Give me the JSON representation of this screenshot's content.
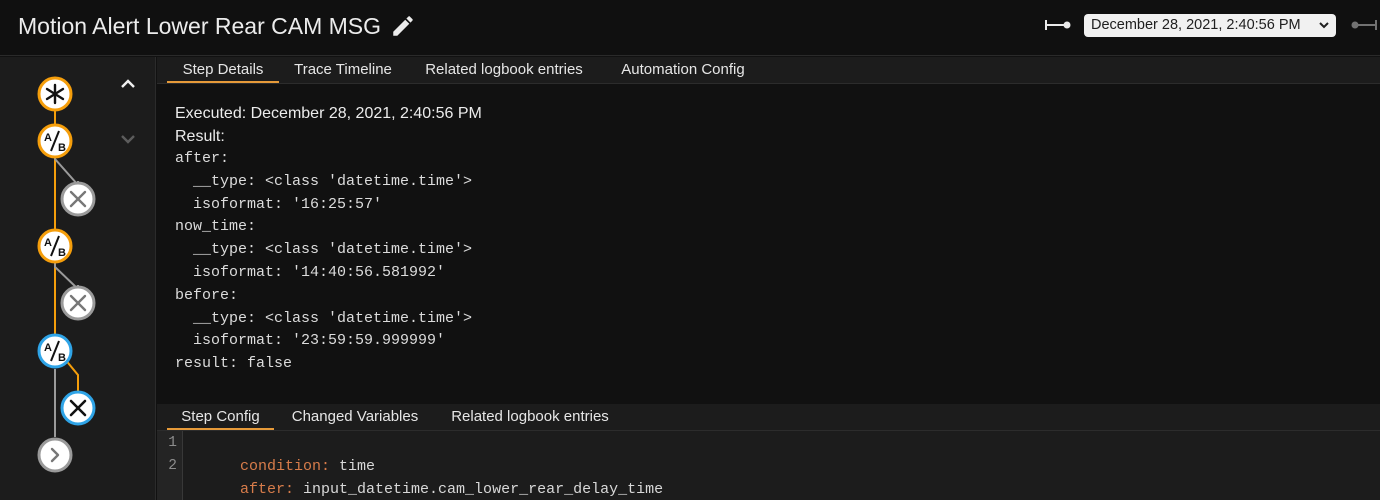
{
  "header": {
    "title": "Motion Alert Lower Rear CAM MSG",
    "trace_selected": "December 28, 2021, 2:40:56 PM"
  },
  "tabs_top": [
    "Step Details",
    "Trace Timeline",
    "Related logbook entries",
    "Automation Config"
  ],
  "details": {
    "executed": "Executed: December 28, 2021, 2:40:56 PM",
    "result_label": "Result:",
    "yaml_lines": [
      "after:",
      "  __type: <class 'datetime.time'>",
      "  isoformat: '16:25:57'",
      "now_time:",
      "  __type: <class 'datetime.time'>",
      "  isoformat: '14:40:56.581992'",
      "before:",
      "  __type: <class 'datetime.time'>",
      "  isoformat: '23:59:59.999999'",
      "result: false"
    ]
  },
  "tabs_bottom": [
    "Step Config",
    "Changed Variables",
    "Related logbook entries"
  ],
  "config": {
    "lines": [
      {
        "num": "1",
        "key": "condition:",
        "value": " time"
      },
      {
        "num": "2",
        "key": "after:",
        "value": " input_datetime.cam_lower_rear_delay_time"
      }
    ]
  },
  "graph": {
    "nodes": [
      {
        "name": "trigger-node",
        "icon": "asterisk-icon",
        "state": "traced"
      },
      {
        "name": "condition-node-1",
        "icon": "a-b-icon",
        "state": "traced"
      },
      {
        "name": "stop-node-1",
        "icon": "close-icon",
        "state": "untraced"
      },
      {
        "name": "condition-node-2",
        "icon": "a-b-icon",
        "state": "traced"
      },
      {
        "name": "stop-node-2",
        "icon": "close-icon",
        "state": "untraced"
      },
      {
        "name": "condition-node-3",
        "icon": "a-b-icon",
        "state": "selected"
      },
      {
        "name": "stop-node-3",
        "icon": "close-icon",
        "state": "selected"
      },
      {
        "name": "action-node",
        "icon": "chevron-right-icon",
        "state": "untraced"
      }
    ]
  },
  "colors": {
    "accent_orange": "#f59e0b",
    "selected_blue": "#2fa4e7",
    "untraced_gray": "#9a9a9a",
    "yaml_key": "#d77c4a"
  }
}
